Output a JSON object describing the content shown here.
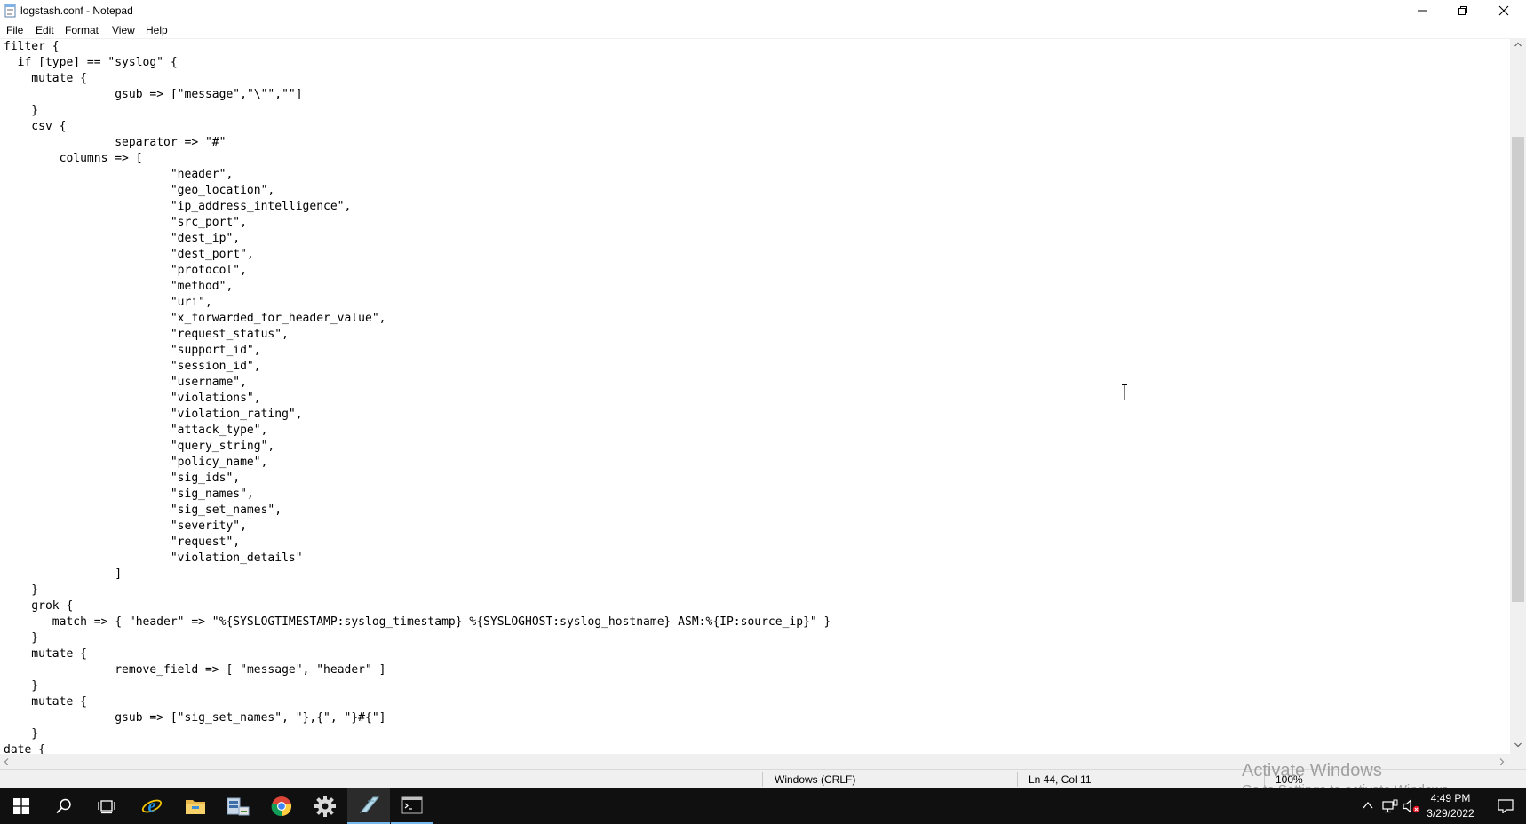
{
  "window": {
    "title": "logstash.conf - Notepad",
    "icon": "notepad-icon"
  },
  "menu": {
    "file": "File",
    "edit": "Edit",
    "format": "Format",
    "view": "View",
    "help": "Help"
  },
  "editor": {
    "content": "filter {\n  if [type] == \"syslog\" {\n    mutate {\n\t\tgsub => [\"message\",\"\\\"\",\"\"]\n    }\n    csv {\n\t\tseparator => \"#\"\n        columns => [\n\t\t\t\"header\",\n\t\t\t\"geo_location\",\n\t\t\t\"ip_address_intelligence\",\n\t\t\t\"src_port\",\n\t\t\t\"dest_ip\",\n\t\t\t\"dest_port\",\n\t\t\t\"protocol\",\n\t\t\t\"method\",\n\t\t\t\"uri\",\n\t\t\t\"x_forwarded_for_header_value\",\n\t\t\t\"request_status\",\n\t\t\t\"support_id\",\n\t\t\t\"session_id\",\n\t\t\t\"username\",\n\t\t\t\"violations\",\n\t\t\t\"violation_rating\",\n\t\t\t\"attack_type\",\n\t\t\t\"query_string\",\n\t\t\t\"policy_name\",\n\t\t\t\"sig_ids\",\n\t\t\t\"sig_names\",\n\t\t\t\"sig_set_names\",\n\t\t\t\"severity\",\n\t\t\t\"request\",\n\t\t\t\"violation_details\"\n\t\t]\n    }\n    grok {\n       match => { \"header\" => \"%{SYSLOGTIMESTAMP:syslog_timestamp} %{SYSLOGHOST:syslog_hostname} ASM:%{IP:source_ip}\" }\n    }\n    mutate {\n\t\tremove_field => [ \"message\", \"header\" ]\n    }\n    mutate {\n\t\tgsub => [\"sig_set_names\", \"},{\", \"}#{\"]\n    }\ndate {"
  },
  "watermark": {
    "title": "Activate Windows",
    "subtitle": "Go to Settings to activate Windows."
  },
  "statusbar": {
    "line_ending": "Windows (CRLF)",
    "position": "Ln 44, Col 11",
    "zoom": "100%"
  },
  "taskbar": {
    "time": "4:49 PM",
    "date": "3/29/2022",
    "apps": [
      "start-icon",
      "search-icon",
      "task-view-icon",
      "internet-explorer-icon",
      "file-explorer-icon",
      "server-manager-icon",
      "chrome-icon",
      "settings-icon",
      "notepad-icon",
      "command-prompt-icon"
    ]
  },
  "colors": {
    "taskbar_bg": "#101010",
    "accent": "#76b9ed",
    "watermark": "#a0a0a0"
  }
}
